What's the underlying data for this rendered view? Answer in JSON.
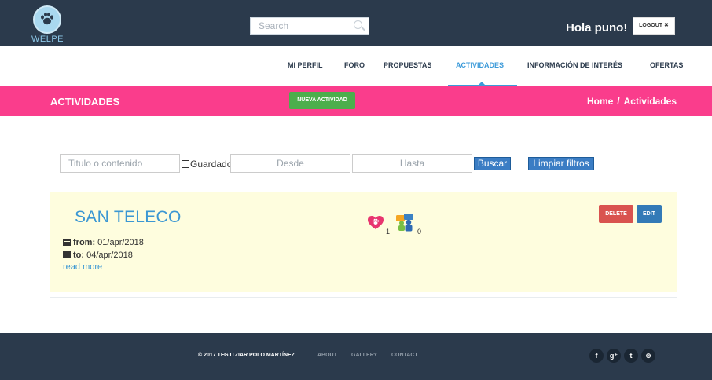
{
  "header": {
    "logo_text": "WELPE",
    "search_placeholder": "Search",
    "greeting": "Hola puno!",
    "logout_label": "LOGOUT ✖"
  },
  "nav": {
    "items": [
      {
        "label": "MI PERFIL"
      },
      {
        "label": "FORO"
      },
      {
        "label": "PROPUESTAS"
      },
      {
        "label": "ACTIVIDADES",
        "active": true
      },
      {
        "label": "INFORMACIÓN DE INTERÉS"
      },
      {
        "label": "OFERTAS"
      }
    ]
  },
  "page_header": {
    "title": "ACTIVIDADES",
    "new_button": "NUEVA ACTIVIDAD",
    "breadcrumb": {
      "home": "Home",
      "separator": "/",
      "current": "Actividades"
    }
  },
  "filters": {
    "title_placeholder": "Titulo o contenido",
    "saved_label": "Guardado",
    "from_placeholder": "Desde",
    "to_placeholder": "Hasta",
    "search_button": "Buscar",
    "clear_button": "Limpiar filtros"
  },
  "activity": {
    "title": "SAN TELECO",
    "from_label": "from:",
    "from_date": "01/apr/2018",
    "to_label": "to:",
    "to_date": "04/apr/2018",
    "read_more": "read more",
    "likes": "1",
    "participants": "0",
    "delete_label": "DELETE",
    "edit_label": "EDIT"
  },
  "footer": {
    "copyright": "© 2017 TFG ITZIAR POLO MARTÍNEZ",
    "links": [
      "ABOUT",
      "GALLERY",
      "CONTACT"
    ],
    "social": [
      {
        "icon": "facebook-icon",
        "glyph": "f"
      },
      {
        "icon": "google-plus-icon",
        "glyph": "g⁺"
      },
      {
        "icon": "twitter-icon",
        "glyph": "t"
      },
      {
        "icon": "dribbble-icon",
        "glyph": "⊛"
      }
    ]
  },
  "colors": {
    "topbar": "#2b3a4c",
    "accent_pink": "#fa3d8c",
    "accent_blue": "#3b9ad9",
    "card_bg": "#fefdde",
    "success": "#4cae4c",
    "danger": "#d9534f",
    "primary": "#337ab7"
  }
}
